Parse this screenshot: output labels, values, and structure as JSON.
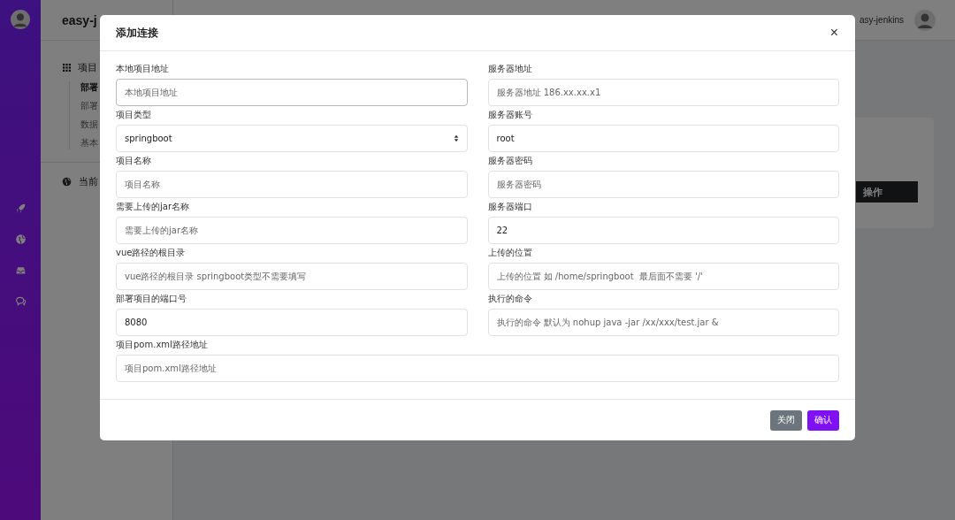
{
  "app": {
    "brand": "easy-j",
    "user": "asy-jenkins",
    "table_header": "操作"
  },
  "sidebar": {
    "section": {
      "label": "项目"
    },
    "items": [
      {
        "label": "部署",
        "selected": true
      },
      {
        "label": "部署",
        "selected": false
      },
      {
        "label": "数据",
        "selected": false
      },
      {
        "label": "基本",
        "selected": false
      }
    ],
    "footer": {
      "label": "当前"
    }
  },
  "dialog": {
    "title": "添加连接",
    "close": "×",
    "fields": [
      {
        "label": "本地项目地址",
        "kind": "text",
        "placeholder": "本地项目地址",
        "focused": true,
        "wide": false
      },
      {
        "label": "服务器地址",
        "kind": "text",
        "placeholder": "服务器地址 186.xx.xx.x1",
        "focused": false,
        "wide": false
      },
      {
        "label": "项目类型",
        "kind": "select",
        "value": "springboot",
        "focused": false,
        "wide": false
      },
      {
        "label": "服务器账号",
        "kind": "text",
        "value": "root",
        "focused": false,
        "wide": false
      },
      {
        "label": "项目名称",
        "kind": "text",
        "placeholder": "项目名称",
        "focused": false,
        "wide": false
      },
      {
        "label": "服务器密码",
        "kind": "text",
        "placeholder": "服务器密码",
        "focused": false,
        "wide": false
      },
      {
        "label": "需要上传的jar名称",
        "kind": "text",
        "placeholder": "需要上传的jar名称",
        "focused": false,
        "wide": false
      },
      {
        "label": "服务器端口",
        "kind": "text",
        "value": "22",
        "focused": false,
        "wide": false
      },
      {
        "label": "vue路径的根目录",
        "kind": "text",
        "placeholder": "vue路径的根目录 springboot类型不需要填写",
        "focused": false,
        "wide": false
      },
      {
        "label": "上传的位置",
        "kind": "text",
        "placeholder": "上传的位置 如 /home/springboot  最后面不需要 '/'",
        "focused": false,
        "wide": false
      },
      {
        "label": "部署项目的端口号",
        "kind": "text",
        "value": "8080",
        "focused": false,
        "wide": false
      },
      {
        "label": "执行的命令",
        "kind": "text",
        "placeholder": "执行的命令 默认为 nohup java -jar /xx/xxx/test.jar &",
        "focused": false,
        "wide": false
      },
      {
        "label": "项目pom.xml路径地址",
        "kind": "text",
        "placeholder": "项目pom.xml路径地址",
        "focused": false,
        "wide": true
      }
    ],
    "buttons": [
      {
        "label": "关闭",
        "kind": "secondary"
      },
      {
        "label": "确认",
        "kind": "primary"
      }
    ]
  }
}
